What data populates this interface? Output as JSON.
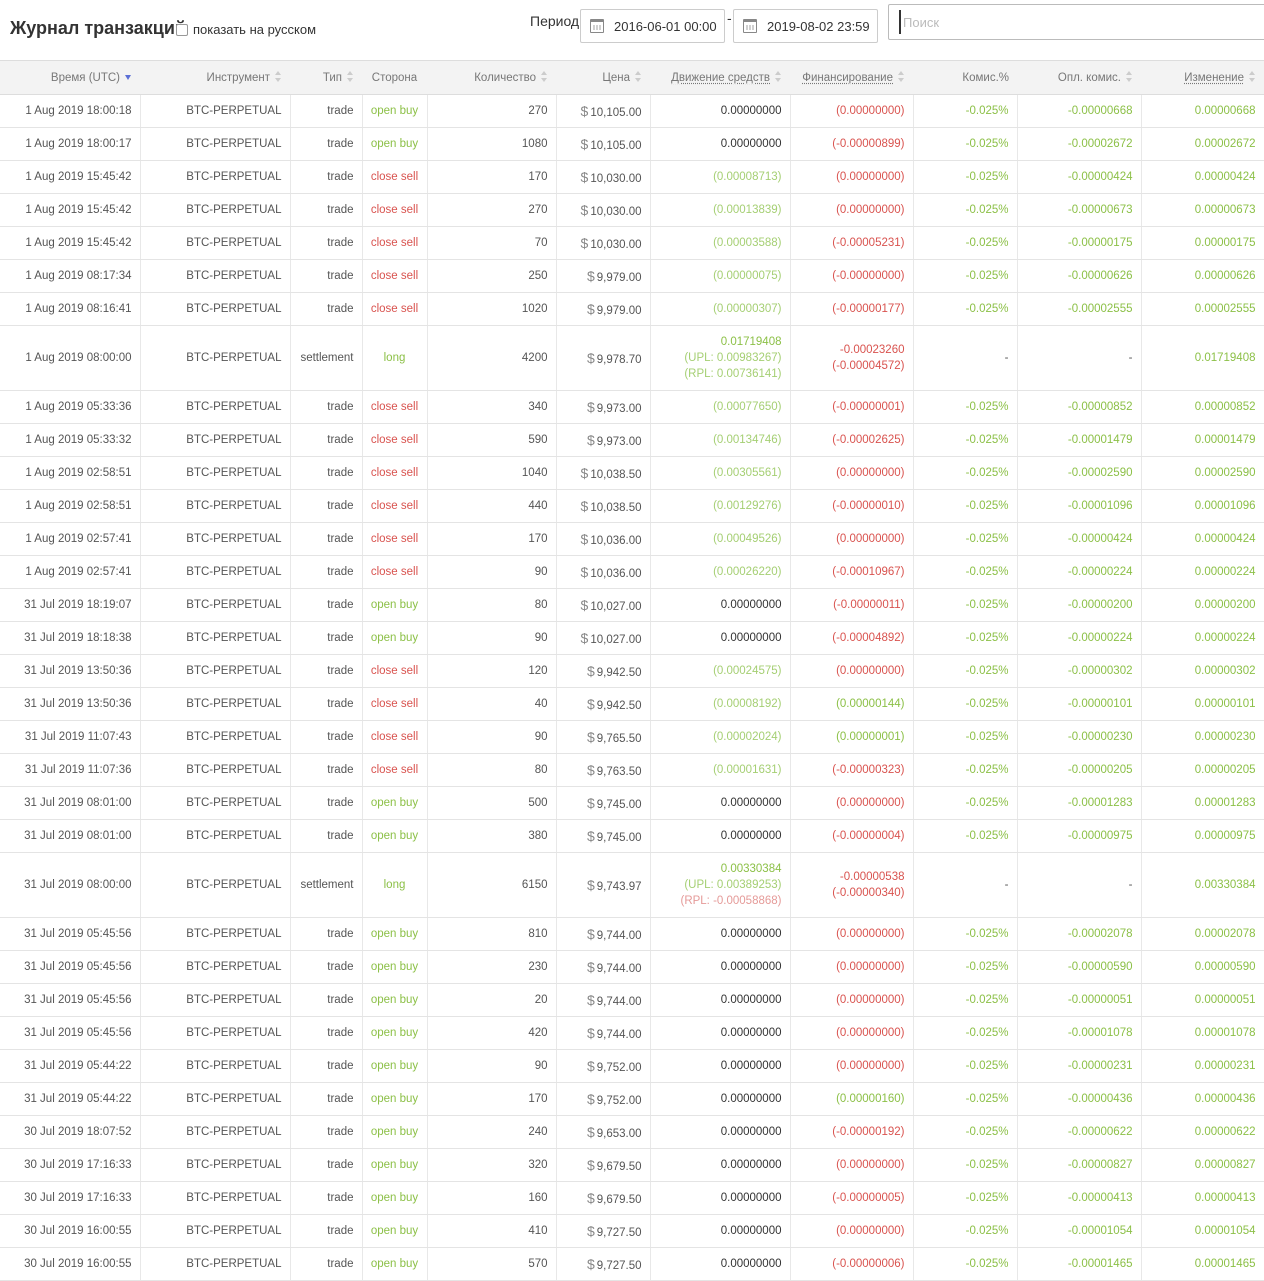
{
  "header": {
    "title": "Журнал транзакций",
    "russian_toggle": "показать на русском",
    "period_label": "Период:",
    "date_from": "2016-06-01 00:00",
    "date_to": "2019-08-02 23:59",
    "date_separator": "-",
    "search_placeholder": "Поиск"
  },
  "colors": {
    "positive": "#8cc047",
    "negative": "#d9534f",
    "header_bg": "#f3f3f3",
    "sort_active": "#5b6fd6"
  },
  "columns": [
    {
      "label": "Время (UTC)",
      "sort": "desc",
      "dotted": false
    },
    {
      "label": "Инструмент",
      "sort": "both",
      "dotted": false
    },
    {
      "label": "Тип",
      "sort": "both",
      "dotted": false
    },
    {
      "label": "Сторона",
      "sort": "none",
      "dotted": false
    },
    {
      "label": "Количество",
      "sort": "both",
      "dotted": false
    },
    {
      "label": "Цена",
      "sort": "both",
      "dotted": false
    },
    {
      "label": "Движение средств",
      "sort": "both",
      "dotted": true
    },
    {
      "label": "Финансирование",
      "sort": "both",
      "dotted": true
    },
    {
      "label": "Комис.%",
      "sort": "none",
      "dotted": false
    },
    {
      "label": "Опл. комис.",
      "sort": "both",
      "dotted": false
    },
    {
      "label": "Изменение",
      "sort": "both",
      "dotted": true
    }
  ],
  "rows": [
    {
      "time": "1 Aug 2019 18:00:18",
      "instrument": "BTC-PERPETUAL",
      "type": "trade",
      "side": "open buy",
      "qty": "270",
      "price": "10,105.00",
      "cash": [
        "0.00000000"
      ],
      "funding": [
        "(0.00000000)"
      ],
      "fee_pct": "-0.025%",
      "fee_paid": "-0.00000668",
      "change": "0.00000668"
    },
    {
      "time": "1 Aug 2019 18:00:17",
      "instrument": "BTC-PERPETUAL",
      "type": "trade",
      "side": "open buy",
      "qty": "1080",
      "price": "10,105.00",
      "cash": [
        "0.00000000"
      ],
      "funding": [
        "(-0.00000899)"
      ],
      "fee_pct": "-0.025%",
      "fee_paid": "-0.00002672",
      "change": "0.00002672"
    },
    {
      "time": "1 Aug 2019 15:45:42",
      "instrument": "BTC-PERPETUAL",
      "type": "trade",
      "side": "close sell",
      "qty": "170",
      "price": "10,030.00",
      "cash": [
        "(0.00008713)"
      ],
      "funding": [
        "(0.00000000)"
      ],
      "fee_pct": "-0.025%",
      "fee_paid": "-0.00000424",
      "change": "0.00000424"
    },
    {
      "time": "1 Aug 2019 15:45:42",
      "instrument": "BTC-PERPETUAL",
      "type": "trade",
      "side": "close sell",
      "qty": "270",
      "price": "10,030.00",
      "cash": [
        "(0.00013839)"
      ],
      "funding": [
        "(0.00000000)"
      ],
      "fee_pct": "-0.025%",
      "fee_paid": "-0.00000673",
      "change": "0.00000673"
    },
    {
      "time": "1 Aug 2019 15:45:42",
      "instrument": "BTC-PERPETUAL",
      "type": "trade",
      "side": "close sell",
      "qty": "70",
      "price": "10,030.00",
      "cash": [
        "(0.00003588)"
      ],
      "funding": [
        "(-0.00005231)"
      ],
      "fee_pct": "-0.025%",
      "fee_paid": "-0.00000175",
      "change": "0.00000175"
    },
    {
      "time": "1 Aug 2019 08:17:34",
      "instrument": "BTC-PERPETUAL",
      "type": "trade",
      "side": "close sell",
      "qty": "250",
      "price": "9,979.00",
      "cash": [
        "(0.00000075)"
      ],
      "funding": [
        "(-0.00000000)"
      ],
      "fee_pct": "-0.025%",
      "fee_paid": "-0.00000626",
      "change": "0.00000626"
    },
    {
      "time": "1 Aug 2019 08:16:41",
      "instrument": "BTC-PERPETUAL",
      "type": "trade",
      "side": "close sell",
      "qty": "1020",
      "price": "9,979.00",
      "cash": [
        "(0.00000307)"
      ],
      "funding": [
        "(-0.00000177)"
      ],
      "fee_pct": "-0.025%",
      "fee_paid": "-0.00002555",
      "change": "0.00002555"
    },
    {
      "time": "1 Aug 2019 08:00:00",
      "instrument": "BTC-PERPETUAL",
      "type": "settlement",
      "side": "long",
      "qty": "4200",
      "price": "9,978.70",
      "cash": [
        "0.01719408",
        "(UPL: 0.00983267)",
        "(RPL: 0.00736141)"
      ],
      "funding": [
        "-0.00023260",
        "(-0.00004572)"
      ],
      "fee_pct": "-",
      "fee_paid": "-",
      "change": "0.01719408"
    },
    {
      "time": "1 Aug 2019 05:33:36",
      "instrument": "BTC-PERPETUAL",
      "type": "trade",
      "side": "close sell",
      "qty": "340",
      "price": "9,973.00",
      "cash": [
        "(0.00077650)"
      ],
      "funding": [
        "(-0.00000001)"
      ],
      "fee_pct": "-0.025%",
      "fee_paid": "-0.00000852",
      "change": "0.00000852"
    },
    {
      "time": "1 Aug 2019 05:33:32",
      "instrument": "BTC-PERPETUAL",
      "type": "trade",
      "side": "close sell",
      "qty": "590",
      "price": "9,973.00",
      "cash": [
        "(0.00134746)"
      ],
      "funding": [
        "(-0.00002625)"
      ],
      "fee_pct": "-0.025%",
      "fee_paid": "-0.00001479",
      "change": "0.00001479"
    },
    {
      "time": "1 Aug 2019 02:58:51",
      "instrument": "BTC-PERPETUAL",
      "type": "trade",
      "side": "close sell",
      "qty": "1040",
      "price": "10,038.50",
      "cash": [
        "(0.00305561)"
      ],
      "funding": [
        "(0.00000000)"
      ],
      "fee_pct": "-0.025%",
      "fee_paid": "-0.00002590",
      "change": "0.00002590"
    },
    {
      "time": "1 Aug 2019 02:58:51",
      "instrument": "BTC-PERPETUAL",
      "type": "trade",
      "side": "close sell",
      "qty": "440",
      "price": "10,038.50",
      "cash": [
        "(0.00129276)"
      ],
      "funding": [
        "(-0.00000010)"
      ],
      "fee_pct": "-0.025%",
      "fee_paid": "-0.00001096",
      "change": "0.00001096"
    },
    {
      "time": "1 Aug 2019 02:57:41",
      "instrument": "BTC-PERPETUAL",
      "type": "trade",
      "side": "close sell",
      "qty": "170",
      "price": "10,036.00",
      "cash": [
        "(0.00049526)"
      ],
      "funding": [
        "(0.00000000)"
      ],
      "fee_pct": "-0.025%",
      "fee_paid": "-0.00000424",
      "change": "0.00000424"
    },
    {
      "time": "1 Aug 2019 02:57:41",
      "instrument": "BTC-PERPETUAL",
      "type": "trade",
      "side": "close sell",
      "qty": "90",
      "price": "10,036.00",
      "cash": [
        "(0.00026220)"
      ],
      "funding": [
        "(-0.00010967)"
      ],
      "fee_pct": "-0.025%",
      "fee_paid": "-0.00000224",
      "change": "0.00000224"
    },
    {
      "time": "31 Jul 2019 18:19:07",
      "instrument": "BTC-PERPETUAL",
      "type": "trade",
      "side": "open buy",
      "qty": "80",
      "price": "10,027.00",
      "cash": [
        "0.00000000"
      ],
      "funding": [
        "(-0.00000011)"
      ],
      "fee_pct": "-0.025%",
      "fee_paid": "-0.00000200",
      "change": "0.00000200"
    },
    {
      "time": "31 Jul 2019 18:18:38",
      "instrument": "BTC-PERPETUAL",
      "type": "trade",
      "side": "open buy",
      "qty": "90",
      "price": "10,027.00",
      "cash": [
        "0.00000000"
      ],
      "funding": [
        "(-0.00004892)"
      ],
      "fee_pct": "-0.025%",
      "fee_paid": "-0.00000224",
      "change": "0.00000224"
    },
    {
      "time": "31 Jul 2019 13:50:36",
      "instrument": "BTC-PERPETUAL",
      "type": "trade",
      "side": "close sell",
      "qty": "120",
      "price": "9,942.50",
      "cash": [
        "(0.00024575)"
      ],
      "funding": [
        "(0.00000000)"
      ],
      "fee_pct": "-0.025%",
      "fee_paid": "-0.00000302",
      "change": "0.00000302"
    },
    {
      "time": "31 Jul 2019 13:50:36",
      "instrument": "BTC-PERPETUAL",
      "type": "trade",
      "side": "close sell",
      "qty": "40",
      "price": "9,942.50",
      "cash": [
        "(0.00008192)"
      ],
      "funding": [
        "(0.00000144)"
      ],
      "fee_pct": "-0.025%",
      "fee_paid": "-0.00000101",
      "change": "0.00000101"
    },
    {
      "time": "31 Jul 2019 11:07:43",
      "instrument": "BTC-PERPETUAL",
      "type": "trade",
      "side": "close sell",
      "qty": "90",
      "price": "9,765.50",
      "cash": [
        "(0.00002024)"
      ],
      "funding": [
        "(0.00000001)"
      ],
      "fee_pct": "-0.025%",
      "fee_paid": "-0.00000230",
      "change": "0.00000230"
    },
    {
      "time": "31 Jul 2019 11:07:36",
      "instrument": "BTC-PERPETUAL",
      "type": "trade",
      "side": "close sell",
      "qty": "80",
      "price": "9,763.50",
      "cash": [
        "(0.00001631)"
      ],
      "funding": [
        "(-0.00000323)"
      ],
      "fee_pct": "-0.025%",
      "fee_paid": "-0.00000205",
      "change": "0.00000205"
    },
    {
      "time": "31 Jul 2019 08:01:00",
      "instrument": "BTC-PERPETUAL",
      "type": "trade",
      "side": "open buy",
      "qty": "500",
      "price": "9,745.00",
      "cash": [
        "0.00000000"
      ],
      "funding": [
        "(0.00000000)"
      ],
      "fee_pct": "-0.025%",
      "fee_paid": "-0.00001283",
      "change": "0.00001283"
    },
    {
      "time": "31 Jul 2019 08:01:00",
      "instrument": "BTC-PERPETUAL",
      "type": "trade",
      "side": "open buy",
      "qty": "380",
      "price": "9,745.00",
      "cash": [
        "0.00000000"
      ],
      "funding": [
        "(-0.00000004)"
      ],
      "fee_pct": "-0.025%",
      "fee_paid": "-0.00000975",
      "change": "0.00000975"
    },
    {
      "time": "31 Jul 2019 08:00:00",
      "instrument": "BTC-PERPETUAL",
      "type": "settlement",
      "side": "long",
      "qty": "6150",
      "price": "9,743.97",
      "cash": [
        "0.00330384",
        "(UPL: 0.00389253)",
        "(RPL: -0.00058868)"
      ],
      "funding": [
        "-0.00000538",
        "(-0.00000340)"
      ],
      "fee_pct": "-",
      "fee_paid": "-",
      "change": "0.00330384"
    },
    {
      "time": "31 Jul 2019 05:45:56",
      "instrument": "BTC-PERPETUAL",
      "type": "trade",
      "side": "open buy",
      "qty": "810",
      "price": "9,744.00",
      "cash": [
        "0.00000000"
      ],
      "funding": [
        "(0.00000000)"
      ],
      "fee_pct": "-0.025%",
      "fee_paid": "-0.00002078",
      "change": "0.00002078"
    },
    {
      "time": "31 Jul 2019 05:45:56",
      "instrument": "BTC-PERPETUAL",
      "type": "trade",
      "side": "open buy",
      "qty": "230",
      "price": "9,744.00",
      "cash": [
        "0.00000000"
      ],
      "funding": [
        "(0.00000000)"
      ],
      "fee_pct": "-0.025%",
      "fee_paid": "-0.00000590",
      "change": "0.00000590"
    },
    {
      "time": "31 Jul 2019 05:45:56",
      "instrument": "BTC-PERPETUAL",
      "type": "trade",
      "side": "open buy",
      "qty": "20",
      "price": "9,744.00",
      "cash": [
        "0.00000000"
      ],
      "funding": [
        "(0.00000000)"
      ],
      "fee_pct": "-0.025%",
      "fee_paid": "-0.00000051",
      "change": "0.00000051"
    },
    {
      "time": "31 Jul 2019 05:45:56",
      "instrument": "BTC-PERPETUAL",
      "type": "trade",
      "side": "open buy",
      "qty": "420",
      "price": "9,744.00",
      "cash": [
        "0.00000000"
      ],
      "funding": [
        "(0.00000000)"
      ],
      "fee_pct": "-0.025%",
      "fee_paid": "-0.00001078",
      "change": "0.00001078"
    },
    {
      "time": "31 Jul 2019 05:44:22",
      "instrument": "BTC-PERPETUAL",
      "type": "trade",
      "side": "open buy",
      "qty": "90",
      "price": "9,752.00",
      "cash": [
        "0.00000000"
      ],
      "funding": [
        "(0.00000000)"
      ],
      "fee_pct": "-0.025%",
      "fee_paid": "-0.00000231",
      "change": "0.00000231"
    },
    {
      "time": "31 Jul 2019 05:44:22",
      "instrument": "BTC-PERPETUAL",
      "type": "trade",
      "side": "open buy",
      "qty": "170",
      "price": "9,752.00",
      "cash": [
        "0.00000000"
      ],
      "funding": [
        "(0.00000160)"
      ],
      "fee_pct": "-0.025%",
      "fee_paid": "-0.00000436",
      "change": "0.00000436"
    },
    {
      "time": "30 Jul 2019 18:07:52",
      "instrument": "BTC-PERPETUAL",
      "type": "trade",
      "side": "open buy",
      "qty": "240",
      "price": "9,653.00",
      "cash": [
        "0.00000000"
      ],
      "funding": [
        "(-0.00000192)"
      ],
      "fee_pct": "-0.025%",
      "fee_paid": "-0.00000622",
      "change": "0.00000622"
    },
    {
      "time": "30 Jul 2019 17:16:33",
      "instrument": "BTC-PERPETUAL",
      "type": "trade",
      "side": "open buy",
      "qty": "320",
      "price": "9,679.50",
      "cash": [
        "0.00000000"
      ],
      "funding": [
        "(0.00000000)"
      ],
      "fee_pct": "-0.025%",
      "fee_paid": "-0.00000827",
      "change": "0.00000827"
    },
    {
      "time": "30 Jul 2019 17:16:33",
      "instrument": "BTC-PERPETUAL",
      "type": "trade",
      "side": "open buy",
      "qty": "160",
      "price": "9,679.50",
      "cash": [
        "0.00000000"
      ],
      "funding": [
        "(-0.00000005)"
      ],
      "fee_pct": "-0.025%",
      "fee_paid": "-0.00000413",
      "change": "0.00000413"
    },
    {
      "time": "30 Jul 2019 16:00:55",
      "instrument": "BTC-PERPETUAL",
      "type": "trade",
      "side": "open buy",
      "qty": "410",
      "price": "9,727.50",
      "cash": [
        "0.00000000"
      ],
      "funding": [
        "(0.00000000)"
      ],
      "fee_pct": "-0.025%",
      "fee_paid": "-0.00001054",
      "change": "0.00001054"
    },
    {
      "time": "30 Jul 2019 16:00:55",
      "instrument": "BTC-PERPETUAL",
      "type": "trade",
      "side": "open buy",
      "qty": "570",
      "price": "9,727.50",
      "cash": [
        "0.00000000"
      ],
      "funding": [
        "(-0.00000006)"
      ],
      "fee_pct": "-0.025%",
      "fee_paid": "-0.00001465",
      "change": "0.00001465"
    }
  ]
}
